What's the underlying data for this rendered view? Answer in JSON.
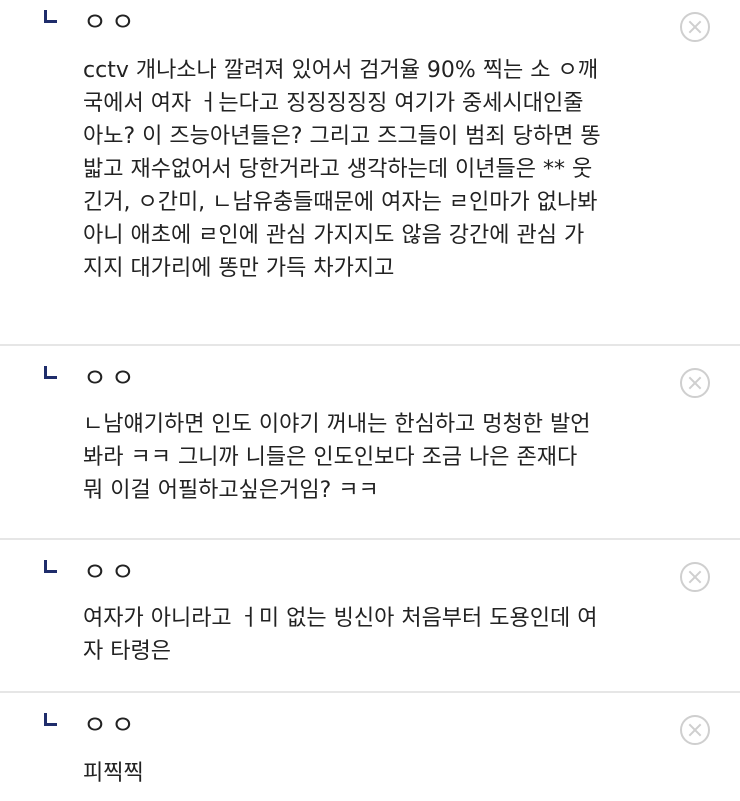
{
  "comments": [
    {
      "author": "ㅇㅇ",
      "text": "cctv 개나소나 깔려져 있어서 검거율 90% 찍는 소 ㅇ깨\n국에서 여자 ㅓ는다고 징징징징징 여기가 중세시대인줄\n아노? 이 즈능아년들은? 그리고 즈그들이 범죄 당하면 똥\n밟고 재수없어서 당한거라고 생각하는데 이년들은 ** 웃\n긴거, ㅇ간미, ㄴ남유충들때문에 여자는 ㄹ인마가 없나봐\n아니 애초에 ㄹ인에 관심 가지지도 않음 강간에 관심 가\n지지 대가리에 똥만 가득 차가지고"
    },
    {
      "author": "ㅇㅇ",
      "text": "ㄴ남얘기하면 인도 이야기 꺼내는 한심하고 멍청한 발언\n봐라 ㅋㅋ 그니까 니들은 인도인보다 조금 나은 존재다\n뭐 이걸 어필하고싶은거임? ㅋㅋ"
    },
    {
      "author": "ㅇㅇ",
      "text": "여자가 아니라고 ㅓ미 없는 빙신아 처음부터 도용인데 여\n자 타령은"
    },
    {
      "author": "ㅇㅇ",
      "text": "피찍찍"
    }
  ]
}
